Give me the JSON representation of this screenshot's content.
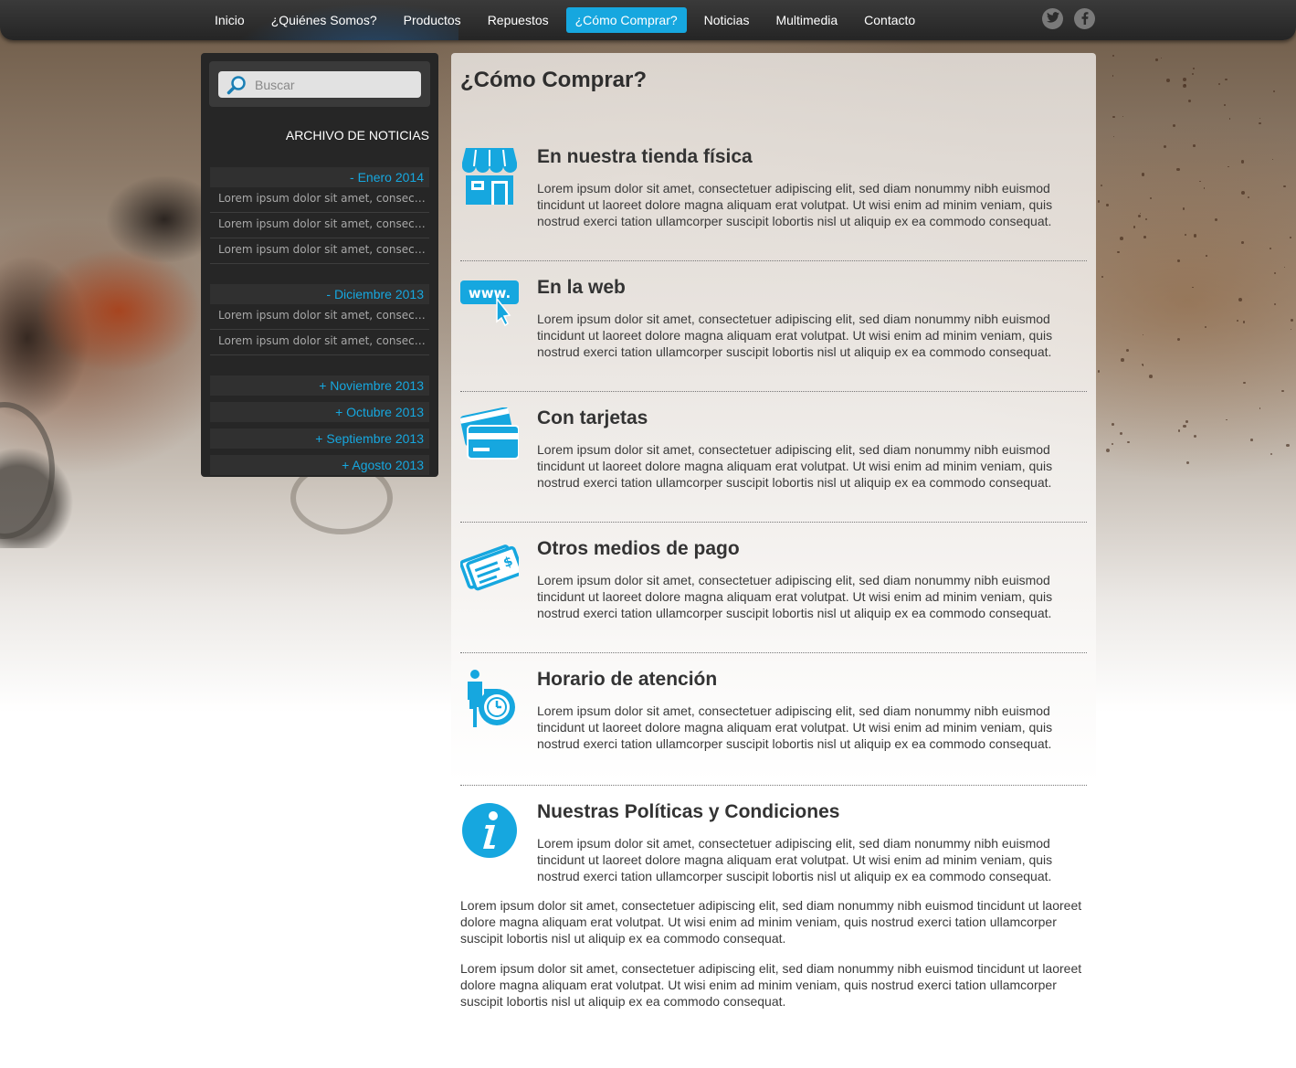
{
  "nav": {
    "items": [
      {
        "label": "Inicio"
      },
      {
        "label": "¿Quiénes Somos?"
      },
      {
        "label": "Productos"
      },
      {
        "label": "Repuestos"
      },
      {
        "label": "¿Cómo Comprar?",
        "active": true
      },
      {
        "label": "Noticias"
      },
      {
        "label": "Multimedia"
      },
      {
        "label": "Contacto"
      }
    ],
    "social": [
      {
        "icon": "twitter-icon"
      },
      {
        "icon": "facebook-icon"
      }
    ],
    "accent_color": "#16a7df"
  },
  "sidebar": {
    "search": {
      "placeholder": "Buscar"
    },
    "archive_title": "ARCHIVO DE NOTICIAS",
    "months": [
      {
        "label": "- Enero 2014",
        "items": [
          "Lorem ipsum dolor sit amet, consectetuer adipiscing elit",
          "Lorem ipsum dolor sit amet, consectetuer adipiscing elit",
          "Lorem ipsum dolor sit amet, consectetuer adipiscing elit"
        ]
      },
      {
        "label": "- Diciembre 2013",
        "items": [
          "Lorem ipsum dolor sit amet, consectetuer adipiscing elit",
          "Lorem ipsum dolor sit amet, consectetuer adipiscing elit"
        ]
      },
      {
        "label": "+ Noviembre 2013"
      },
      {
        "label": "+ Octubre 2013"
      },
      {
        "label": "+ Septiembre 2013"
      },
      {
        "label": "+ Agosto 2013"
      }
    ]
  },
  "main": {
    "title": "¿Cómo Comprar?",
    "sections": [
      {
        "icon": "store-icon",
        "title": "En nuestra tienda física",
        "text": "Lorem ipsum dolor sit amet, consectetuer adipiscing elit, sed diam nonummy nibh euismod tincidunt ut laoreet dolore magna aliquam erat volutpat. Ut wisi enim ad minim veniam, quis nostrud exerci tation ullamcorper suscipit lobortis nisl ut aliquip ex ea commodo consequat."
      },
      {
        "icon": "www-icon",
        "title": "En la web",
        "text": "Lorem ipsum dolor sit amet, consectetuer adipiscing elit, sed diam nonummy nibh euismod tincidunt ut laoreet dolore magna aliquam erat volutpat. Ut wisi enim ad minim veniam, quis nostrud exerci tation ullamcorper suscipit lobortis nisl ut aliquip ex ea commodo consequat."
      },
      {
        "icon": "credit-card-icon",
        "title": "Con tarjetas",
        "text": "Lorem ipsum dolor sit amet, consectetuer adipiscing elit, sed diam nonummy nibh euismod tincidunt ut laoreet dolore magna aliquam erat volutpat. Ut wisi enim ad minim veniam, quis nostrud exerci tation ullamcorper suscipit lobortis nisl ut aliquip ex ea commodo consequat."
      },
      {
        "icon": "check-icon",
        "title": "Otros medios de pago",
        "text": "Lorem ipsum dolor sit amet, consectetuer adipiscing elit, sed diam nonummy nibh euismod tincidunt ut laoreet dolore magna aliquam erat volutpat. Ut wisi enim ad minim veniam, quis nostrud exerci tation ullamcorper suscipit lobortis nisl ut aliquip ex ea commodo consequat."
      },
      {
        "icon": "clock-person-icon",
        "title": "Horario de atención",
        "text": "Lorem ipsum dolor sit amet, consectetuer adipiscing elit, sed diam nonummy nibh euismod tincidunt ut laoreet dolore magna aliquam erat volutpat. Ut wisi enim ad minim veniam, quis nostrud exerci tation ullamcorper suscipit lobortis nisl ut aliquip ex ea commodo consequat."
      },
      {
        "icon": "info-icon",
        "title": "Nuestras Políticas y Condiciones",
        "text": "Lorem ipsum dolor sit amet, consectetuer adipiscing elit, sed diam nonummy nibh euismod tincidunt ut laoreet dolore magna aliquam erat volutpat. Ut wisi enim ad minim veniam, quis nostrud exerci tation ullamcorper suscipit lobortis nisl ut aliquip ex ea commodo consequat."
      }
    ],
    "paragraphs": [
      "Lorem ipsum dolor sit amet, consectetuer adipiscing elit, sed diam nonummy nibh euismod tincidunt ut laoreet dolore magna aliquam erat volutpat. Ut wisi enim ad minim veniam, quis nostrud exerci tation ullamcorper suscipit lobortis nisl ut aliquip ex ea commodo consequat.",
      "Lorem ipsum dolor sit amet, consectetuer adipiscing elit, sed diam nonummy nibh euismod tincidunt ut laoreet dolore magna aliquam erat volutpat. Ut wisi enim ad minim veniam, quis nostrud exerci tation ullamcorper suscipit lobortis nisl ut aliquip ex ea commodo consequat."
    ]
  }
}
